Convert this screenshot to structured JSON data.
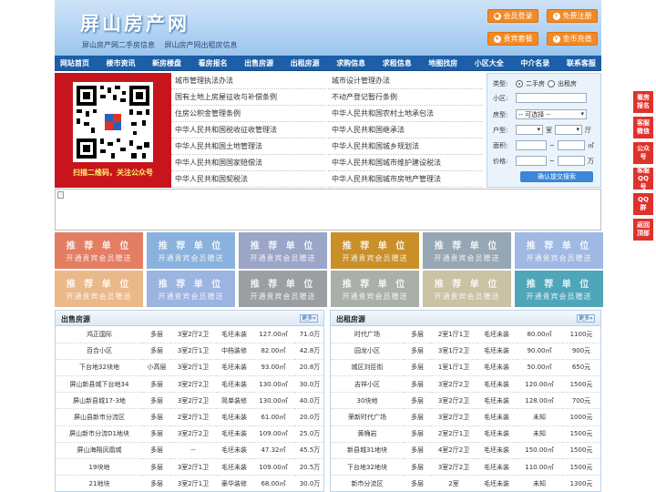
{
  "header": {
    "title": "屏山房产网",
    "subtitles": [
      "屏山房产网二手房信息",
      "屏山房产网出租房信息"
    ],
    "buttons": [
      {
        "label": "会员登录",
        "icon": "user-icon"
      },
      {
        "label": "免费注册",
        "icon": "register-icon"
      },
      {
        "label": "贵宾套餐",
        "icon": "vip-icon"
      },
      {
        "label": "金币充值",
        "icon": "coin-icon"
      }
    ],
    "colors": {
      "accent": "#f08a24",
      "nav": "#1c5fa8"
    }
  },
  "nav": [
    "网站首页",
    "楼市资讯",
    "新房楼盘",
    "看房报名",
    "出售房源",
    "出租房源",
    "求购信息",
    "求租信息",
    "地图找房",
    "小区大全",
    "中介名录",
    "联系客服"
  ],
  "qr": {
    "caption": "扫描二维码，关注公众号"
  },
  "links": {
    "left": [
      "城市管理执法办法",
      "国有土地上房屋征收与补偿条例",
      "住房公积金管理条例",
      "中华人民共和国税收征收管理法",
      "中华人民共和国土地管理法",
      "中华人民共和国国家赔偿法",
      "中华人民共和国契税法"
    ],
    "right": [
      "城市设计管理办法",
      "不动产登记暂行条例",
      "中华人民共和国农村土地承包法",
      "中华人民共和国继承法",
      "中华人民共和国城乡规划法",
      "中华人民共和国城市维护建设税法",
      "中华人民共和国城市房地产管理法"
    ]
  },
  "search": {
    "type_label": "类型:",
    "type_options": [
      "二手房",
      "出租房"
    ],
    "community_label": "小区:",
    "housetype_label": "房型:",
    "housetype_value": "-- 可选择 --",
    "layout_label": "户型:",
    "room_unit": "室",
    "hall_unit": "厅",
    "area_label": "面积:",
    "area_sep": "~",
    "area_unit": "㎡",
    "price_label": "价格:",
    "price_sep": "~",
    "price_unit": "万",
    "submit_label": "确认提交搜索"
  },
  "recommend": {
    "title": "推 荐 单 位",
    "subtitle": "开通贵宾会员赠送",
    "colors": [
      "#e37e63",
      "#8ab2de",
      "#9aa5c8",
      "#c9902a",
      "#96a6b4",
      "#9fb9e4",
      "#eab98a",
      "#9bb4e0",
      "#9b9fa3",
      "#aab0a8",
      "#c9c2a3",
      "#4fa6b8"
    ]
  },
  "sale": {
    "title": "出售房源",
    "more": "更多»",
    "rows": [
      [
        "鸿正国际",
        "多层",
        "3室2厅2卫",
        "毛坯未装",
        "127.00㎡",
        "71.0万"
      ],
      [
        "百合小区",
        "多层",
        "3室2厅1卫",
        "中档装修",
        "82.00㎡",
        "42.8万"
      ],
      [
        "下台地32块地",
        "小高层",
        "3室2厅1卫",
        "毛坯未装",
        "93.00㎡",
        "20.8万"
      ],
      [
        "屏山新县城下台地34",
        "多层",
        "3室2厅2卫",
        "毛坯未装",
        "130.00㎡",
        "30.0万"
      ],
      [
        "屏山新县城17-3地",
        "多层",
        "3室2厅2卫",
        "简单装修",
        "130.00㎡",
        "40.0万"
      ],
      [
        "屏山县新市分流区",
        "多层",
        "2室2厅1卫",
        "毛坯未装",
        "61.00㎡",
        "20.0万"
      ],
      [
        "屏山新市分流D1地块",
        "多层",
        "3室2厅2卫",
        "毛坯未装",
        "109.00㎡",
        "25.0万"
      ],
      [
        "屏山海翔凤凰城",
        "多层",
        "--",
        "毛坯未装",
        "47.32㎡",
        "45.5万"
      ],
      [
        "19块地",
        "多层",
        "3室2厅1卫",
        "毛坯未装",
        "109.00㎡",
        "20.5万"
      ],
      [
        "21地块",
        "多层",
        "3室2厅1卫",
        "豪华装修",
        "68.00㎡",
        "30.0万"
      ]
    ]
  },
  "rent": {
    "title": "出租房源",
    "more": "更多»",
    "rows": [
      [
        "时代广场",
        "多层",
        "2室1厅1卫",
        "毛坯未装",
        "80.00㎡",
        "1100元"
      ],
      [
        "园龙小区",
        "多层",
        "3室1厅2卫",
        "毛坯未装",
        "90.00㎡",
        "900元"
      ],
      [
        "城区刘臣街",
        "多层",
        "1室1厅1卫",
        "毛坯未装",
        "50.00㎡",
        "650元"
      ],
      [
        "吉祥小区",
        "多层",
        "3室2厅2卫",
        "毛坯未装",
        "120.00㎡",
        "1500元"
      ],
      [
        "30块地",
        "多层",
        "3室2厅2卫",
        "毛坯未装",
        "128.00㎡",
        "700元"
      ],
      [
        "荣新时代广场",
        "多层",
        "3室2厅2卫",
        "毛坯未装",
        "未知",
        "1000元"
      ],
      [
        "黄桷岩",
        "多层",
        "2室2厅1卫",
        "毛坯未装",
        "未知",
        "1500元"
      ],
      [
        "新县城31地块",
        "多层",
        "4室2厅2卫",
        "毛坯未装",
        "150.00㎡",
        "1500元"
      ],
      [
        "下台地32地块",
        "多层",
        "3室2厅2卫",
        "毛坯未装",
        "110.00㎡",
        "1500元"
      ],
      [
        "新市分流区",
        "多层",
        "2室",
        "毛坯未装",
        "未知",
        "1300元"
      ]
    ]
  },
  "floatbar": [
    "看房报名",
    "客服微信",
    "公众号",
    "客服QQ号",
    "QQ群",
    "返回顶部"
  ]
}
